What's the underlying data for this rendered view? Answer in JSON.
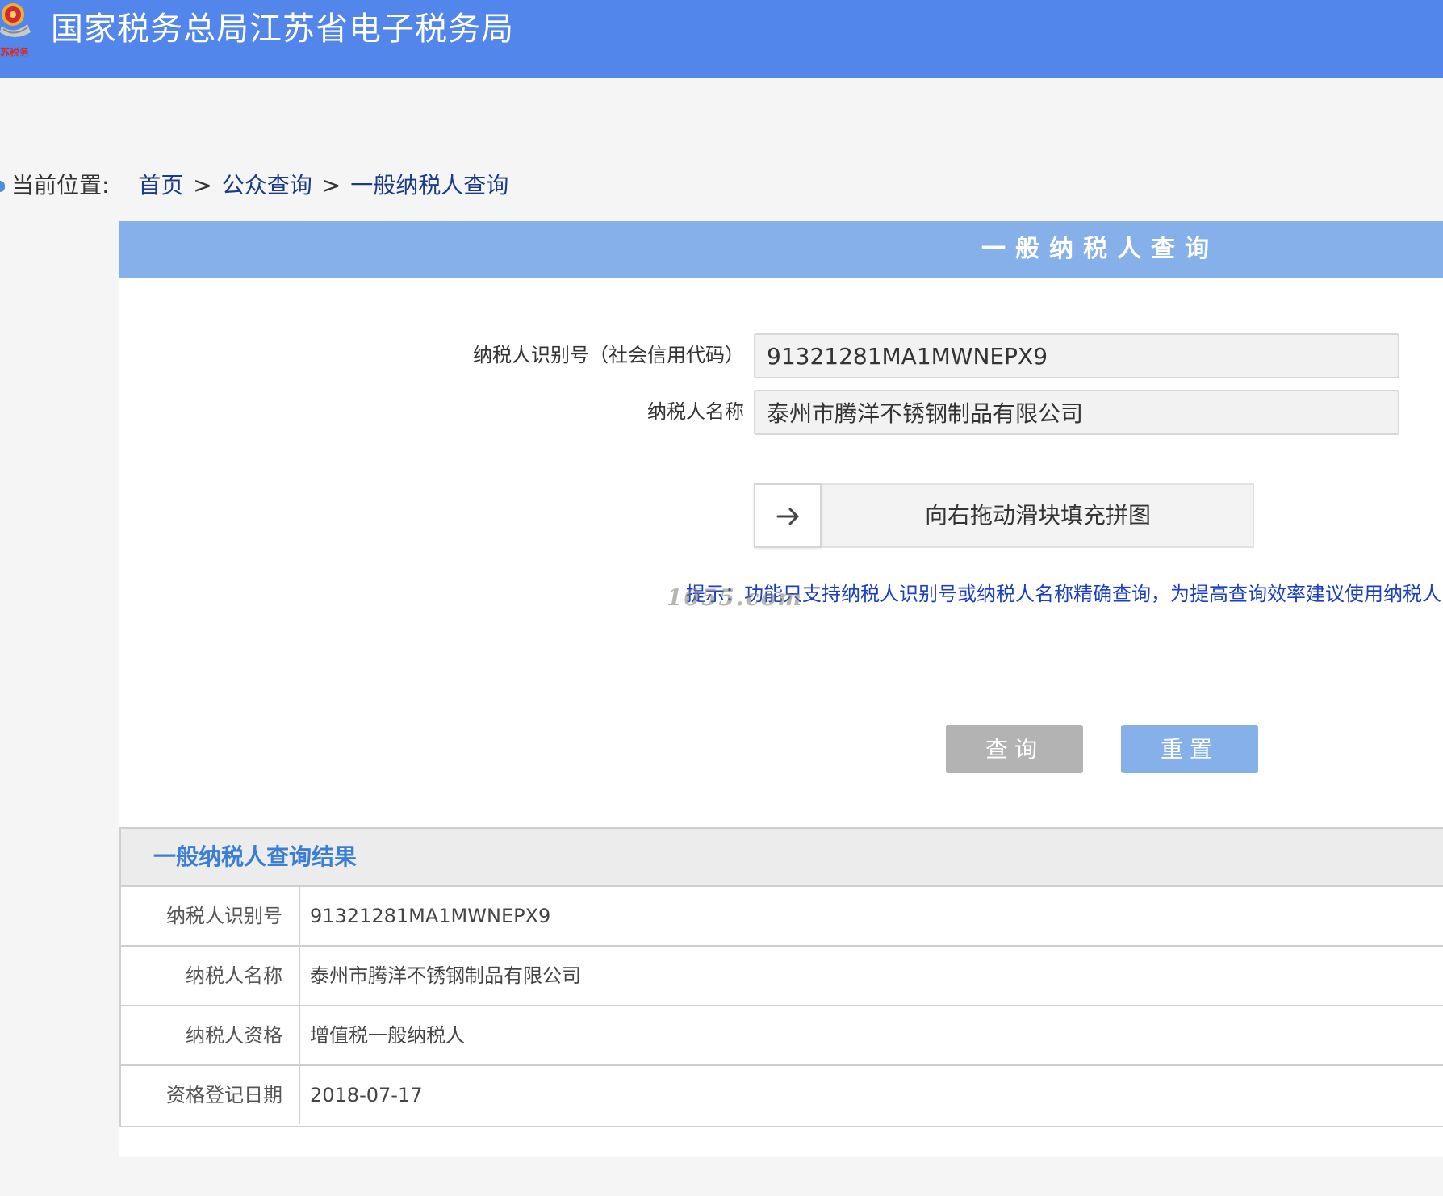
{
  "header": {
    "logo_text": "苏税务",
    "site_title": "国家税务总局江苏省电子税务局",
    "color": "#5386ea"
  },
  "breadcrumb": {
    "prefix": "当前位置:",
    "items": [
      "首页",
      "公众查询",
      "一般纳税人查询"
    ],
    "separator": ">"
  },
  "form": {
    "panel_title": "一般纳税人查询",
    "tax_id_label": "纳税人识别号（社会信用代码）",
    "tax_id_value": "91321281MA1MWNEPX9",
    "name_label": "纳税人名称",
    "name_value": "泰州市腾洋不锈钢制品有限公司",
    "slider_text": "向右拖动滑块填充拼图",
    "slider_icon": "arrow-right-icon",
    "hint": "提示：功能只支持纳税人识别号或纳税人名称精确查询，为提高查询效率建议使用纳税人",
    "watermark": "1055.com",
    "query_button": "查询",
    "reset_button": "重置"
  },
  "results": {
    "title": "一般纳税人查询结果",
    "rows": [
      {
        "label": "纳税人识别号",
        "value": "91321281MA1MWNEPX9"
      },
      {
        "label": "纳税人名称",
        "value": "泰州市腾洋不锈钢制品有限公司"
      },
      {
        "label": "纳税人资格",
        "value": "增值税一般纳税人"
      },
      {
        "label": "资格登记日期",
        "value": "2018-07-17"
      }
    ]
  },
  "colors": {
    "header_bg": "#5386ea",
    "panel_header_bg": "#85b0ea",
    "hint_text": "#1b3fbf",
    "results_title": "#3b7fd4",
    "query_button_bg": "#b3b3b3",
    "reset_button_bg": "#85b0ea"
  }
}
